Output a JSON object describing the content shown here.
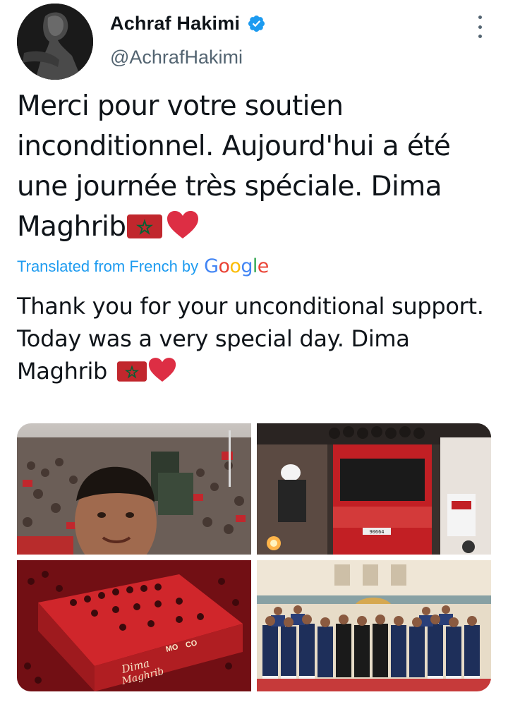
{
  "author": {
    "display_name": "Achraf Hakimi",
    "handle": "@AchrafHakimi",
    "verified": true
  },
  "tweet": {
    "text_lines": [
      "Merci pour votre soutien",
      "inconditionnel. Aujourd'hui a été",
      "une journée très spéciale. Dima",
      "Maghrib"
    ],
    "emojis": [
      "morocco-flag",
      "red-heart"
    ]
  },
  "translation": {
    "label": "Translated from French by",
    "provider": {
      "letters": [
        "G",
        "o",
        "o",
        "g",
        "l",
        "e"
      ]
    },
    "text_lines": [
      "Thank you for your unconditional support.",
      "Today was a very special day. Dima",
      "Maghrib "
    ]
  },
  "media": {
    "bus_sign_1": "Dima",
    "bus_sign_2": "Maghrib",
    "bus_sign_3": "MO",
    "bus_sign_4": "CO",
    "bus_plate": "90664"
  },
  "colors": {
    "link": "#1d9bf0",
    "verified": "#1d9bf0",
    "text": "#0f1419",
    "secondary": "#536471",
    "flag_red": "#c1272d",
    "flag_green": "#006233"
  }
}
